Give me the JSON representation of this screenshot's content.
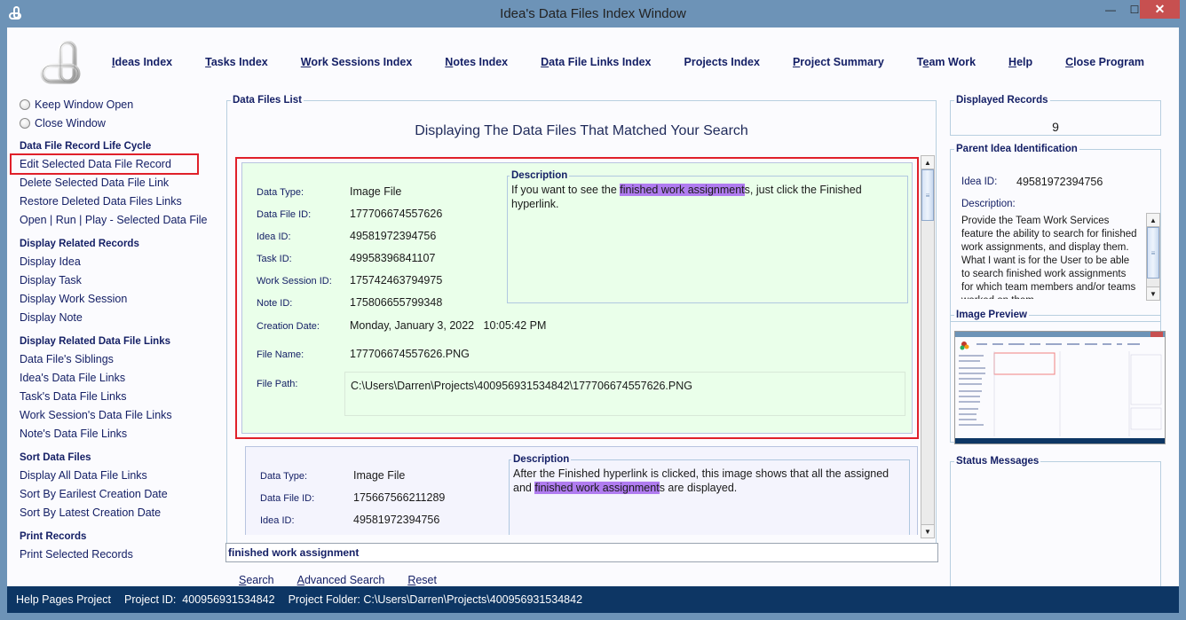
{
  "window": {
    "title": "Idea's Data Files Index Window",
    "controls": {
      "minimize": "—",
      "maximize": "☐",
      "close": "✕"
    }
  },
  "topnav": [
    {
      "label": "Ideas Index",
      "mnemonic": "I"
    },
    {
      "label": "Tasks Index",
      "mnemonic": "T"
    },
    {
      "label": "Work Sessions Index",
      "mnemonic": "W"
    },
    {
      "label": "Notes Index",
      "mnemonic": "N"
    },
    {
      "label": "Data File Links Index",
      "mnemonic": "D"
    },
    {
      "label": "Projects Index",
      "mnemonic": ""
    },
    {
      "label": "Project Summary",
      "mnemonic": "P"
    },
    {
      "label": "Team Work",
      "mnemonic": "e"
    },
    {
      "label": "Help",
      "mnemonic": "H"
    },
    {
      "label": "Close Program",
      "mnemonic": "C"
    }
  ],
  "left": {
    "radios": [
      {
        "label": "Keep Window Open",
        "checked": false
      },
      {
        "label": "Close Window",
        "checked": false
      }
    ],
    "sections": [
      {
        "title": "Data File Record Life Cycle",
        "items": [
          "Edit Selected Data File Record",
          "Delete Selected Data File Link",
          "Restore Deleted Data Files Links",
          "Open | Run | Play - Selected Data File"
        ]
      },
      {
        "title": "Display Related Records",
        "items": [
          "Display Idea",
          "Display Task",
          "Display Work Session",
          "Display Note"
        ]
      },
      {
        "title": "Display Related Data File Links",
        "items": [
          "Data File's Siblings",
          "Idea's Data File Links",
          "Task's Data File Links",
          "Work Session's Data File Links",
          "Note's Data File Links"
        ]
      },
      {
        "title": "Sort Data Files",
        "items": [
          "Display All Data File Links",
          "Sort By Earilest Creation Date",
          "Sort By Latest Creation Date"
        ]
      },
      {
        "title": "Print Records",
        "items": [
          "Print Selected Records"
        ]
      }
    ]
  },
  "main": {
    "group_title": "Data Files List",
    "heading": "Displaying The Data Files That Matched Your Search",
    "labels": {
      "data_type": "Data Type:",
      "data_file_id": "Data File ID:",
      "idea_id": "Idea ID:",
      "task_id": "Task ID:",
      "work_session_id": "Work Session ID:",
      "note_id": "Note ID:",
      "creation_date": "Creation Date:",
      "file_name": "File Name:",
      "file_path": "File Path:",
      "description": "Description"
    },
    "records": [
      {
        "data_type": "Image File",
        "data_file_id": "177706674557626",
        "idea_id": "49581972394756",
        "task_id": "49958396841107",
        "work_session_id": "175742463794975",
        "note_id": "175806655799348",
        "creation_date": "Monday, January 3, 2022   10:05:42 PM",
        "file_name": "177706674557626.PNG",
        "file_path": "C:\\Users\\Darren\\Projects\\400956931534842\\177706674557626.PNG",
        "desc_before": "If you want to see the ",
        "desc_match": "finished work assignment",
        "desc_after": "s, just click the Finished hyperlink."
      },
      {
        "data_type": "Image File",
        "data_file_id": "175667566211289",
        "idea_id": "49581972394756",
        "desc_before": "After the Finished hyperlink is clicked, this image shows that all the assigned and ",
        "desc_match": "finished work assignment",
        "desc_after": "s are displayed."
      }
    ],
    "search": {
      "value": "finished work assignment",
      "buttons": [
        {
          "label": "Search",
          "mnemonic": "S"
        },
        {
          "label": "Advanced Search",
          "mnemonic": "A"
        },
        {
          "label": "Reset",
          "mnemonic": "R"
        }
      ]
    }
  },
  "right": {
    "displayed_records": {
      "title": "Displayed Records",
      "count": "9"
    },
    "parent_idea": {
      "title": "Parent Idea Identification",
      "idea_id_label": "Idea ID:",
      "idea_id": "49581972394756",
      "description_label": "Description:",
      "description": "Provide the Team Work Services feature the ability to search for finished work assignments, and display them. What I want is for the User to be able to search finished work assignments for which team members and/or teams worked on them."
    },
    "image_preview": {
      "title": "Image Preview"
    },
    "status_messages": {
      "title": "Status Messages"
    }
  },
  "statusbar": {
    "project_name": "Help Pages Project",
    "project_id": "Project ID:  400956931534842",
    "project_folder": "Project Folder: C:\\Users\\Darren\\Projects\\400956931534842"
  },
  "colors": {
    "titlebar": "#6d93b7",
    "link_text": "#152066",
    "selected_record_bg": "#eaffea",
    "highlight_frame": "#e0202a",
    "match_highlight": "#b07cf0",
    "statusbar_bg": "#0d3664",
    "close_button": "#c75050"
  }
}
